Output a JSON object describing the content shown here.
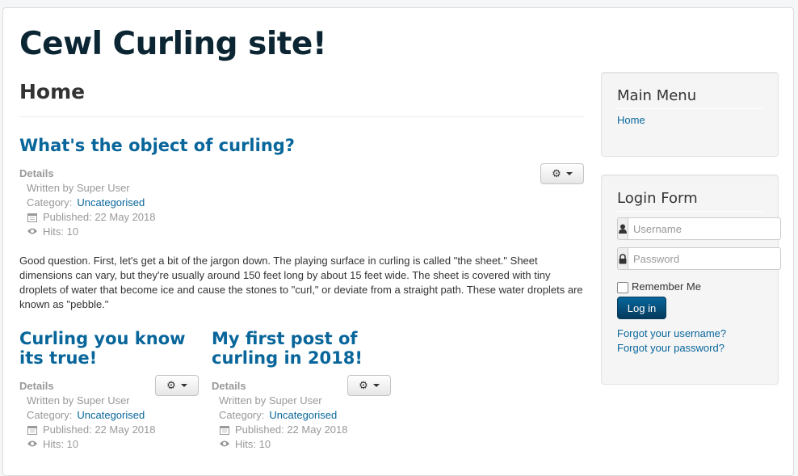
{
  "site": {
    "title": "Cewl Curling site!"
  },
  "page": {
    "header": "Home"
  },
  "articles": [
    {
      "title": "What's the object of curling?",
      "details_label": "Details",
      "author": "Written by Super User",
      "category_label": "Category:",
      "category": "Uncategorised",
      "published": "Published: 22 May 2018",
      "hits": "Hits: 10",
      "body": "Good question. First, let's get a bit of the jargon down. The playing surface in curling is called \"the sheet.\" Sheet dimensions can vary, but they're usually around 150 feet long by about 15 feet wide. The sheet is covered with tiny droplets of water that become ice and cause the stones to \"curl,\" or deviate from a straight path. These water droplets are known as \"pebble.\""
    },
    {
      "title": "Curling you know its true!",
      "details_label": "Details",
      "author": "Written by Super User",
      "category_label": "Category:",
      "category": "Uncategorised",
      "published": "Published: 22 May 2018",
      "hits": "Hits: 10"
    },
    {
      "title": "My first post of curling in 2018!",
      "details_label": "Details",
      "author": "Written by Super User",
      "category_label": "Category:",
      "category": "Uncategorised",
      "published": "Published: 22 May 2018",
      "hits": "Hits: 10"
    }
  ],
  "main_menu": {
    "title": "Main Menu",
    "items": [
      "Home"
    ]
  },
  "login_form": {
    "title": "Login Form",
    "username_placeholder": "Username",
    "password_placeholder": "Password",
    "remember_label": "Remember Me",
    "login_button": "Log in",
    "forgot_username": "Forgot your username?",
    "forgot_password": "Forgot your password?"
  },
  "icons": {
    "gear": "gear-icon",
    "calendar": "calendar-icon",
    "eye": "eye-icon",
    "user": "user-icon",
    "lock": "lock-icon"
  },
  "colors": {
    "link": "#08669b",
    "title": "#0b2533",
    "button": "#08669b"
  }
}
